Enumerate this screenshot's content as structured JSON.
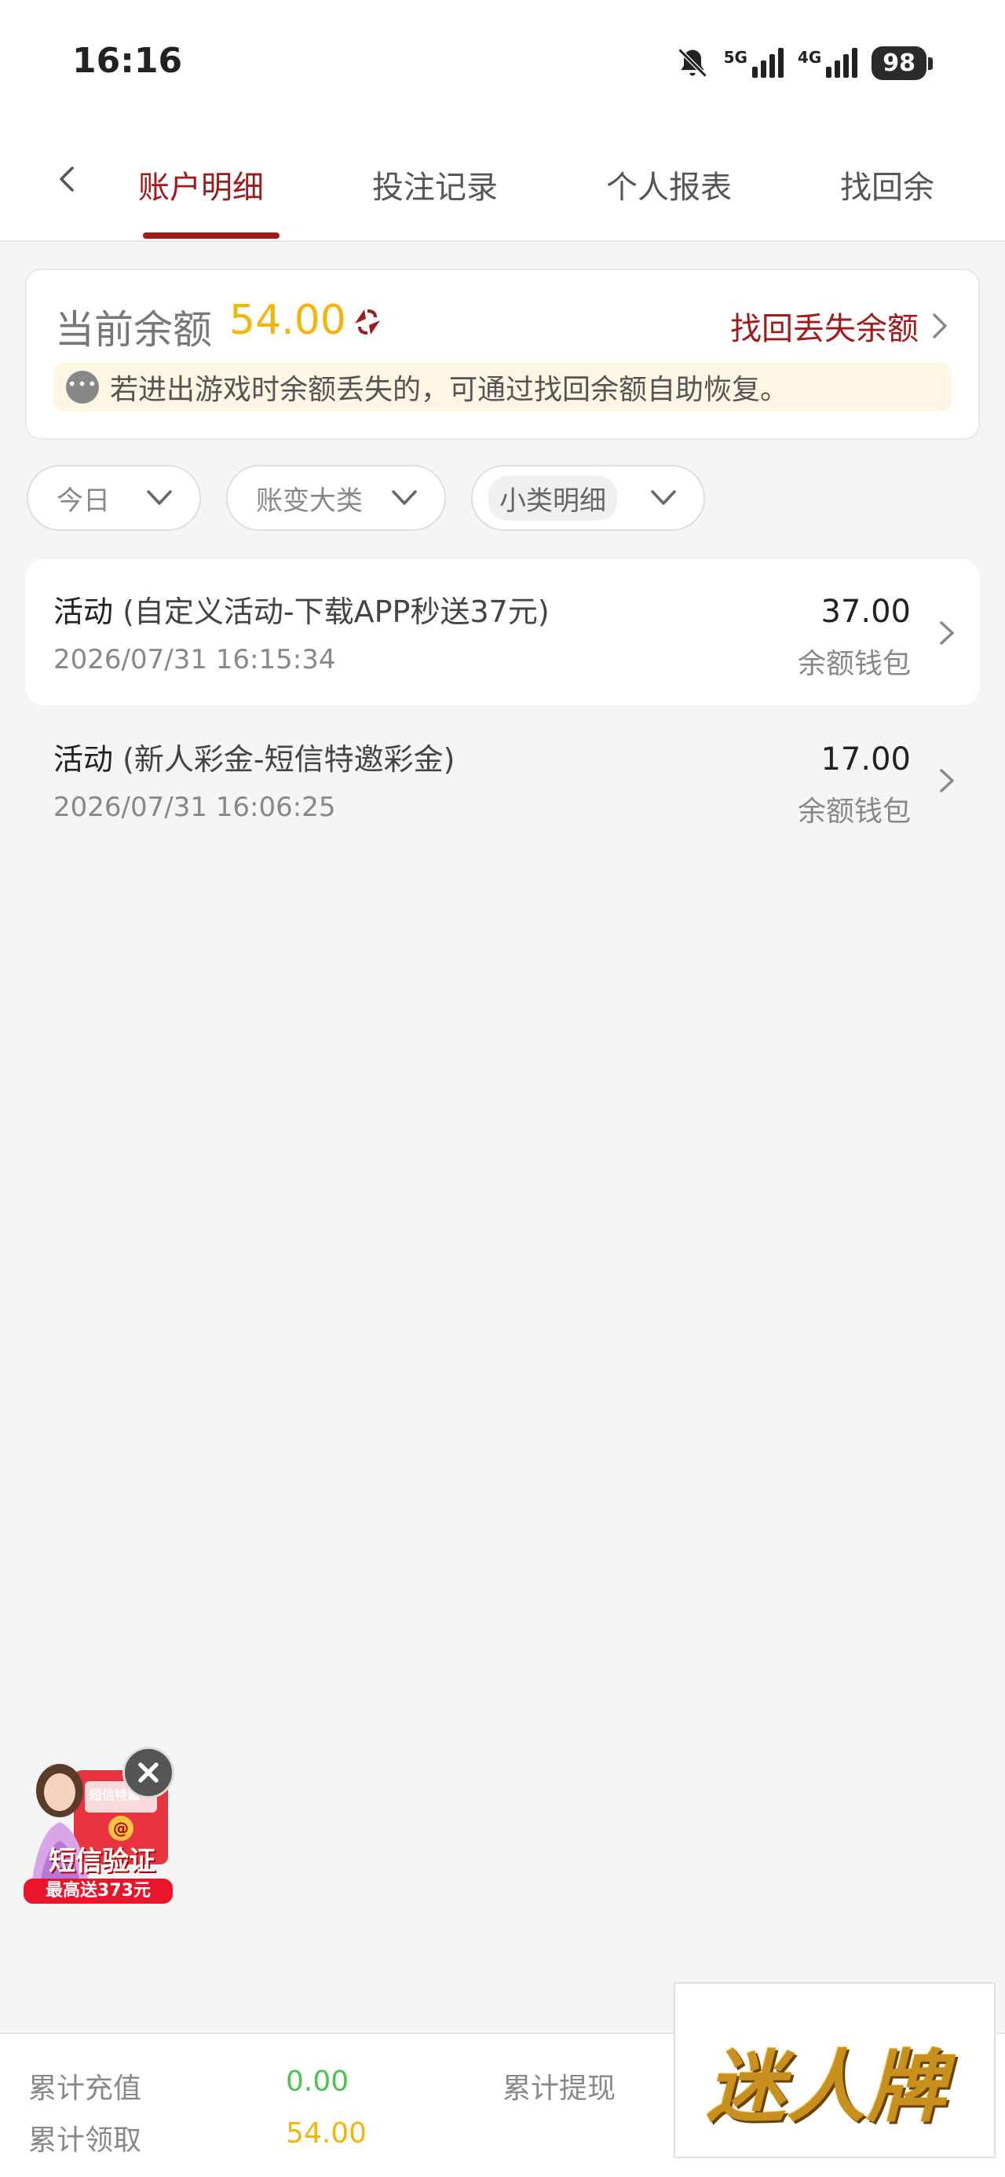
{
  "status_bar": {
    "time": "16:16",
    "net1": "5G",
    "net2": "4G",
    "battery": "98"
  },
  "tabs": [
    {
      "label": "账户明细",
      "active": true
    },
    {
      "label": "投注记录",
      "active": false
    },
    {
      "label": "个人报表",
      "active": false
    },
    {
      "label": "找回余",
      "active": false
    }
  ],
  "balance": {
    "label": "当前余额",
    "value": "54.00",
    "recover_label": "找回丢失余额",
    "notice": "若进出游戏时余额丢失的，可通过找回余额自助恢复。"
  },
  "filters": [
    {
      "label": "今日"
    },
    {
      "label": "账变大类"
    },
    {
      "label": "小类明细"
    }
  ],
  "records": [
    {
      "type": "活动",
      "detail": "(自定义活动-下载APP秒送37元)",
      "time": "2026/07/31 16:15:34",
      "amount": "37.00",
      "wallet": "余额钱包"
    },
    {
      "type": "活动",
      "detail": "(新人彩金-短信特邀彩金)",
      "time": "2026/07/31 16:06:25",
      "amount": "17.00",
      "wallet": "余额钱包"
    }
  ],
  "promo": {
    "line1": "短信验证",
    "line2": "最高送373元",
    "tag": "短信特邀"
  },
  "footer": {
    "recharge_label": "累计充值",
    "recharge_value": "0.00",
    "withdraw_label": "累计提现",
    "claim_label": "累计领取",
    "claim_value": "54.00"
  },
  "logo": {
    "text": "迷人牌"
  },
  "colors": {
    "accent": "#a01b1b",
    "gold": "#f5b40b",
    "green": "#4cc34c"
  }
}
